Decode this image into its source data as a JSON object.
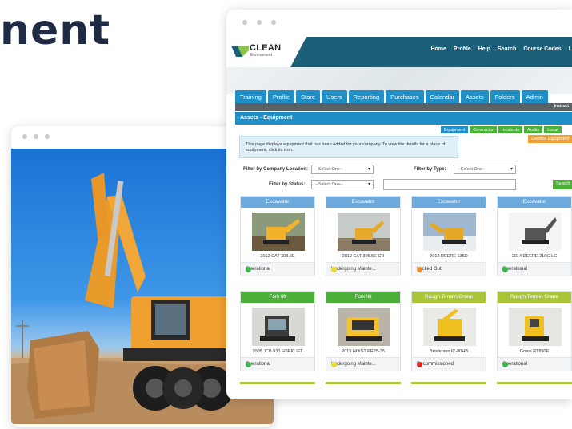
{
  "hero": {
    "heading_fragment": "nent"
  },
  "browser": {
    "logo": {
      "name": "CLEAN",
      "sub": "Environment"
    },
    "top_nav": [
      "Home",
      "Profile",
      "Help",
      "Search",
      "Course Codes",
      "L"
    ],
    "tabs": [
      "Training",
      "Profile",
      "Store",
      "Users",
      "Reporting",
      "Purchases",
      "Calendar",
      "Assets",
      "Folders",
      "Admin"
    ],
    "instructions_label": "Instruct",
    "section_title": "Assets - Equipment",
    "subtabs": [
      "Equipment",
      "Contractor",
      "Incidents",
      "Audits",
      "Locat"
    ],
    "info_text": "This page displays equipment that has been added for your company. To view the details for a place of equipment, click its icon.",
    "deleted_button": "Deleted Equipment",
    "filters": {
      "location_label": "Filter by Company Location:",
      "location_value": "--Select One--",
      "type_label": "Filter by Type:",
      "type_value": "--Select One--",
      "status_label": "Filter by Status:",
      "status_value": "--Select One--",
      "search_button": "Search"
    },
    "cards": [
      {
        "type": "Excavator",
        "name": "2012 CAT 303.5E",
        "status": "Operational",
        "head": "blue",
        "dot": "#3cb54a"
      },
      {
        "type": "Excavator",
        "name": "2012 CAT 305.5E CR",
        "status": "Undergoing Mainte...",
        "head": "blue",
        "dot": "#e8d92a"
      },
      {
        "type": "Excavator",
        "name": "2012 DEERE 135D",
        "status": "Locked Out",
        "head": "blue",
        "dot": "#f08a24"
      },
      {
        "type": "Excavator",
        "name": "2014 DEERE 210G LC",
        "status": "Operational",
        "head": "blue",
        "dot": "#3cb54a"
      },
      {
        "type": "Fork lift",
        "name": "2005 JCB 930 FORKLIFT",
        "status": "Operational",
        "head": "green",
        "dot": "#3cb54a"
      },
      {
        "type": "Fork lift",
        "name": "2019 HOIST PR25-35",
        "status": "Undergoing Mainte...",
        "head": "green",
        "dot": "#e8d92a"
      },
      {
        "type": "Rough Terrain Crane",
        "name": "Broderson IC-80HB",
        "status": "Decommissioned",
        "head": "lime",
        "dot": "#d9261c"
      },
      {
        "type": "Rough Terrain Crane",
        "name": "Grove RT890E",
        "status": "Operational",
        "head": "lime",
        "dot": "#3cb54a"
      }
    ]
  }
}
